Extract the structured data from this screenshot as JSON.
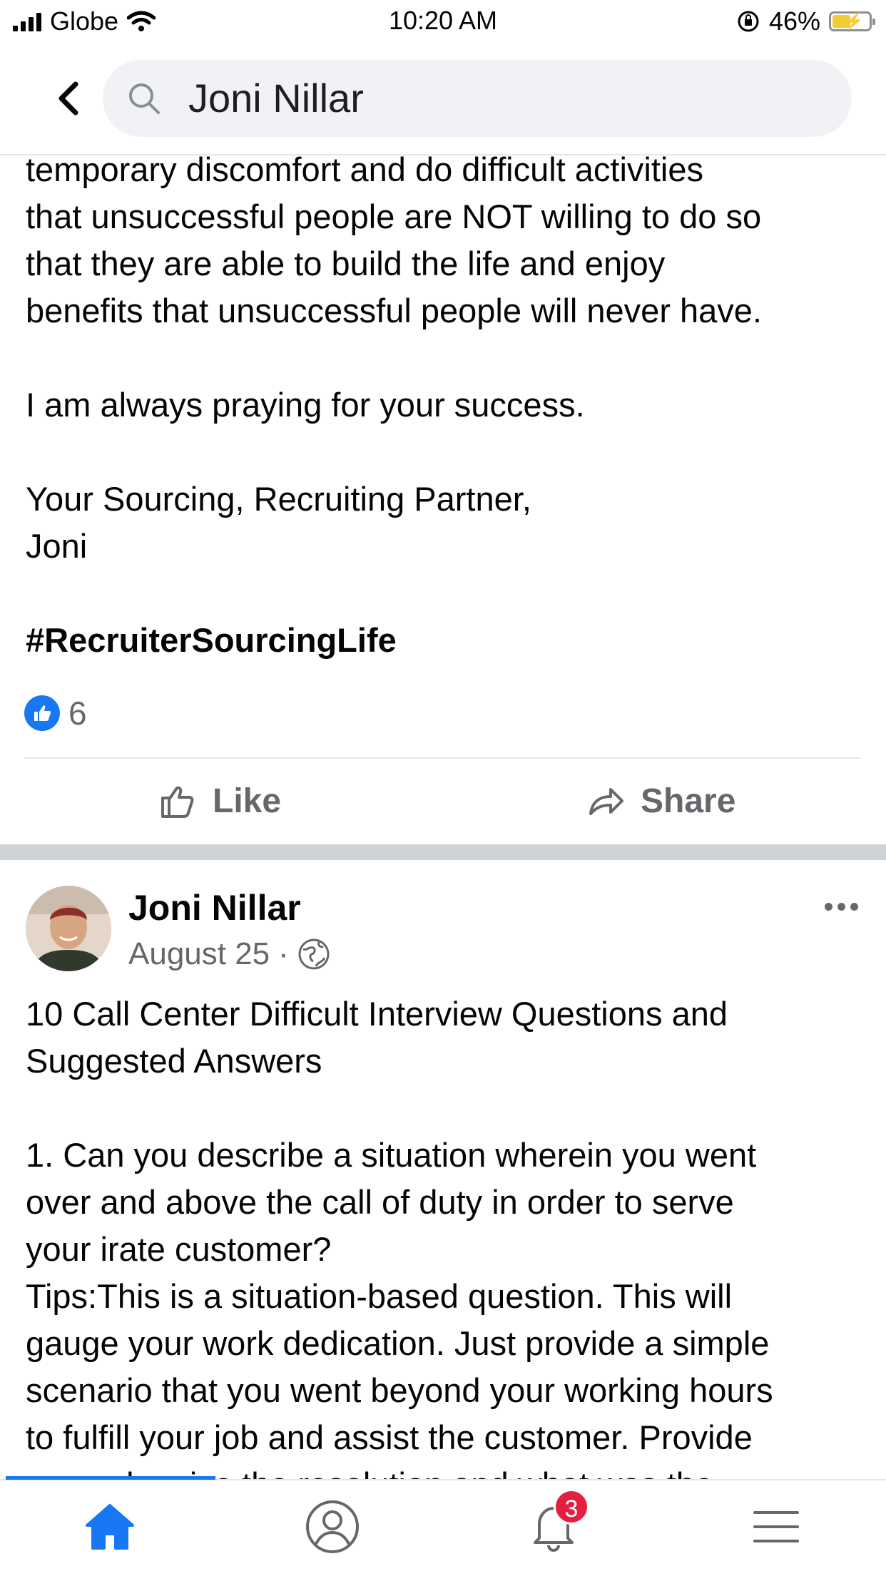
{
  "status_bar": {
    "carrier": "Globe",
    "time": "10:20 AM",
    "battery_percent": "46%"
  },
  "search": {
    "query": "Joni Nillar"
  },
  "previous_post": {
    "lines": [
      "temporary discomfort and do difficult activities",
      "that unsuccessful people are NOT willing to do so",
      "that they are able to build the life and enjoy",
      "benefits that unsuccessful people will never have.",
      "I am always praying for your success.",
      "Your Sourcing, Recruiting Partner,",
      "Joni"
    ],
    "hashtag": "#RecruiterSourcingLife",
    "reaction_count": "6",
    "like_label": "Like",
    "share_label": "Share"
  },
  "post": {
    "author": "Joni Nillar",
    "date": "August 25",
    "separator": "·",
    "lines": [
      "10 Call Center Difficult Interview Questions and",
      "Suggested Answers",
      "1. Can you describe a situation wherein you went",
      "over and above the call of duty in order to serve",
      "your irate customer?",
      "Tips:This is a situation-based question.  This will",
      "gauge your work dedication. Just provide a simple",
      "scenario that you went beyond your working hours",
      "to fulfill your job and assist the customer. Provide",
      "example, give the resolution and what was the"
    ]
  },
  "tabbar": {
    "notification_count": "3",
    "icons": [
      "home-icon",
      "profile-icon",
      "bell-icon",
      "menu-icon"
    ],
    "active": "home"
  },
  "colors": {
    "accent": "#1877f2",
    "badge": "#e41e3f",
    "secondary_text": "#65676b"
  }
}
